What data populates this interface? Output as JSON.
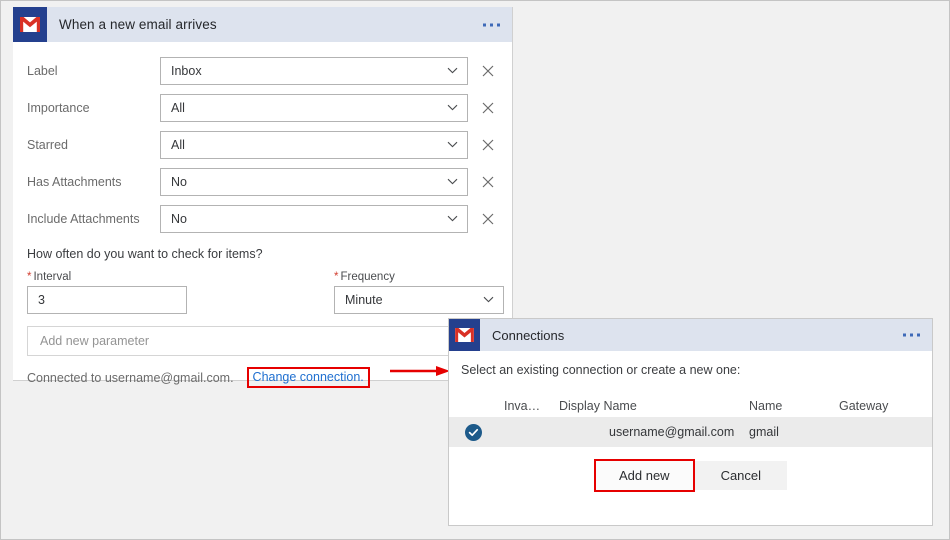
{
  "colors": {
    "header_bg": "#dde3ee",
    "gmail_blue": "#24408e",
    "gmail_red": "#d93025",
    "link_blue": "#1f6fd0",
    "highlight_red": "#e60000",
    "required_star": "#d23f31",
    "page_bg": "#f1f1f1",
    "row_selected_bg": "#ebebeb",
    "check_badge": "#1d5a8a"
  },
  "trigger_card": {
    "icon": "gmail-icon",
    "title": "When a new email arrives",
    "overflow_menu": "ellipsis-icon",
    "fields": [
      {
        "label": "Label",
        "value": "Inbox",
        "chevron": "chevron-down-icon",
        "clear": "close-icon"
      },
      {
        "label": "Importance",
        "value": "All",
        "chevron": "chevron-down-icon",
        "clear": "close-icon"
      },
      {
        "label": "Starred",
        "value": "All",
        "chevron": "chevron-down-icon",
        "clear": "close-icon"
      },
      {
        "label": "Has Attachments",
        "value": "No",
        "chevron": "chevron-down-icon",
        "clear": "close-icon"
      },
      {
        "label": "Include Attachments",
        "value": "No",
        "chevron": "chevron-down-icon",
        "clear": "close-icon"
      }
    ],
    "recurrence_question": "How often do you want to check for items?",
    "interval": {
      "star": "*",
      "label": "Interval",
      "value": "3"
    },
    "frequency": {
      "star": "*",
      "label": "Frequency",
      "value": "Minute",
      "chevron": "chevron-down-icon"
    },
    "add_parameter_placeholder": "Add new parameter",
    "connected_text": "Connected to username@gmail.com.",
    "change_connection_link": "Change connection."
  },
  "annotation": {
    "arrow": "red-arrow-icon"
  },
  "connections_dialog": {
    "icon": "gmail-icon",
    "title": "Connections",
    "overflow_menu": "ellipsis-icon",
    "subtitle": "Select an existing connection or create a new one:",
    "table": {
      "columns": [
        "Inva…",
        "Display Name",
        "Name",
        "Gateway"
      ],
      "rows": [
        {
          "invalid": "check-circle-icon",
          "display_name": "username@gmail.com",
          "name": "gmail",
          "gateway": ""
        }
      ]
    },
    "buttons": {
      "add_new": "Add new",
      "cancel": "Cancel"
    }
  }
}
